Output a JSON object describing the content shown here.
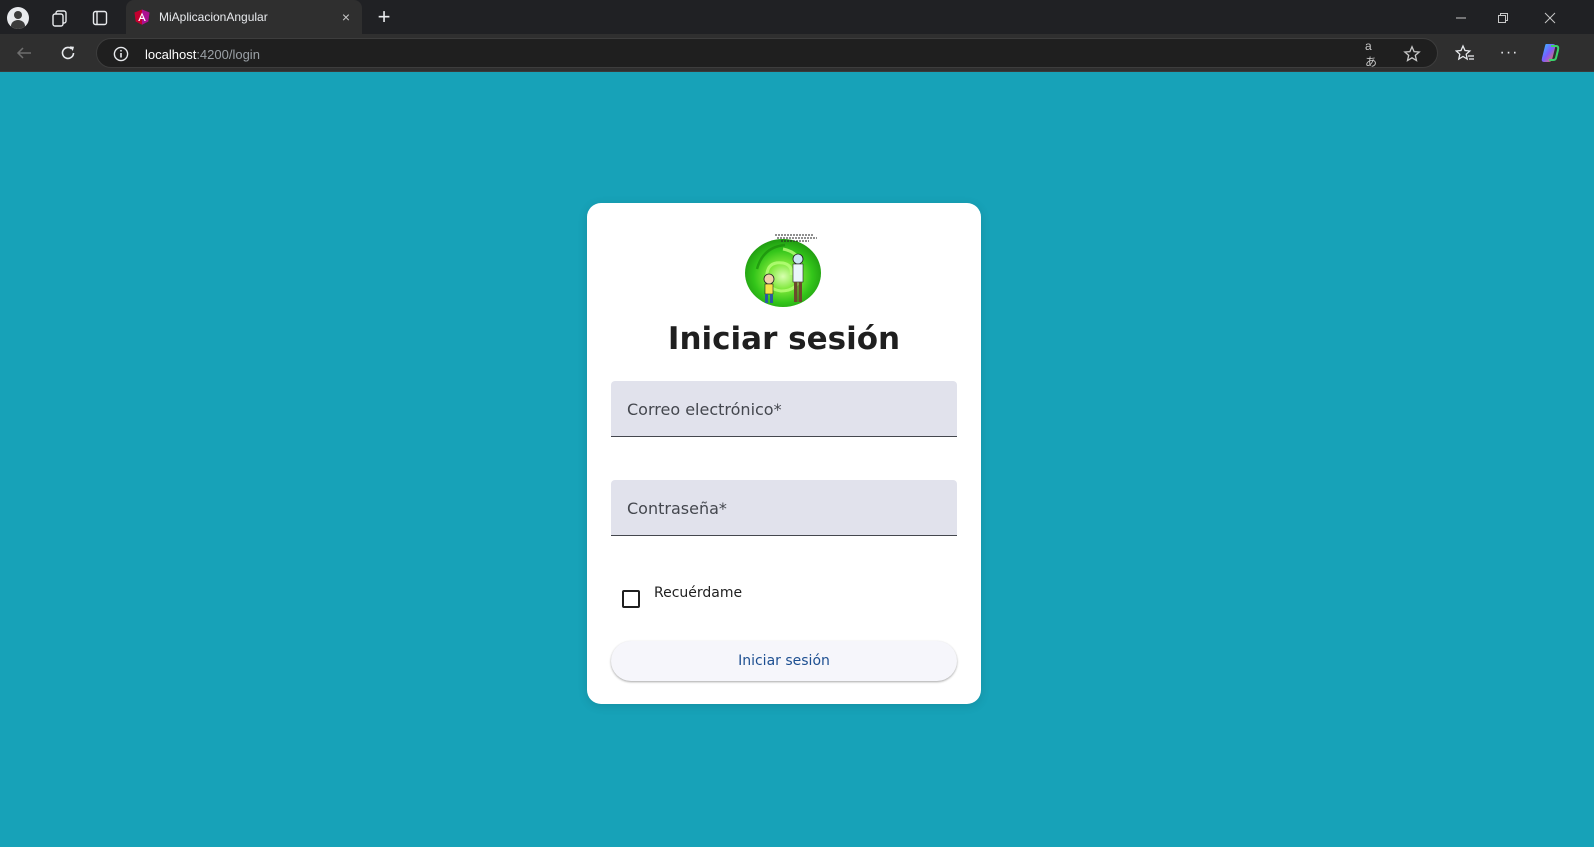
{
  "browser": {
    "tab": {
      "title": "MiAplicacionAngular",
      "close_glyph": "×"
    },
    "new_tab_glyph": "+",
    "address": {
      "host": "localhost",
      "path": ":4200/login"
    },
    "icons": {
      "profile": "profile-icon",
      "workspaces": "workspaces-icon",
      "tab_actions": "tab-actions-icon",
      "back": "back-arrow-icon",
      "reload": "reload-icon",
      "site_info": "info-icon",
      "translate": "translate-icon",
      "favorite": "star-icon",
      "favorites": "favorites-icon",
      "more": "more-icon",
      "copilot": "copilot-icon"
    },
    "translate_glyph": "aあ",
    "more_glyph": "···"
  },
  "colors": {
    "page_background": "#17a2b8",
    "card_background": "#ffffff",
    "field_background": "#e1e2ec",
    "button_text": "#1d4f91",
    "angular_brand": "#c3002f"
  },
  "login": {
    "logo": "portal-logo",
    "title": "Iniciar sesión",
    "email_label": "Correo electrónico*",
    "password_label": "Contraseña*",
    "remember_label": "Recuérdame",
    "remember_checked": false,
    "submit_label": "Iniciar sesión"
  }
}
